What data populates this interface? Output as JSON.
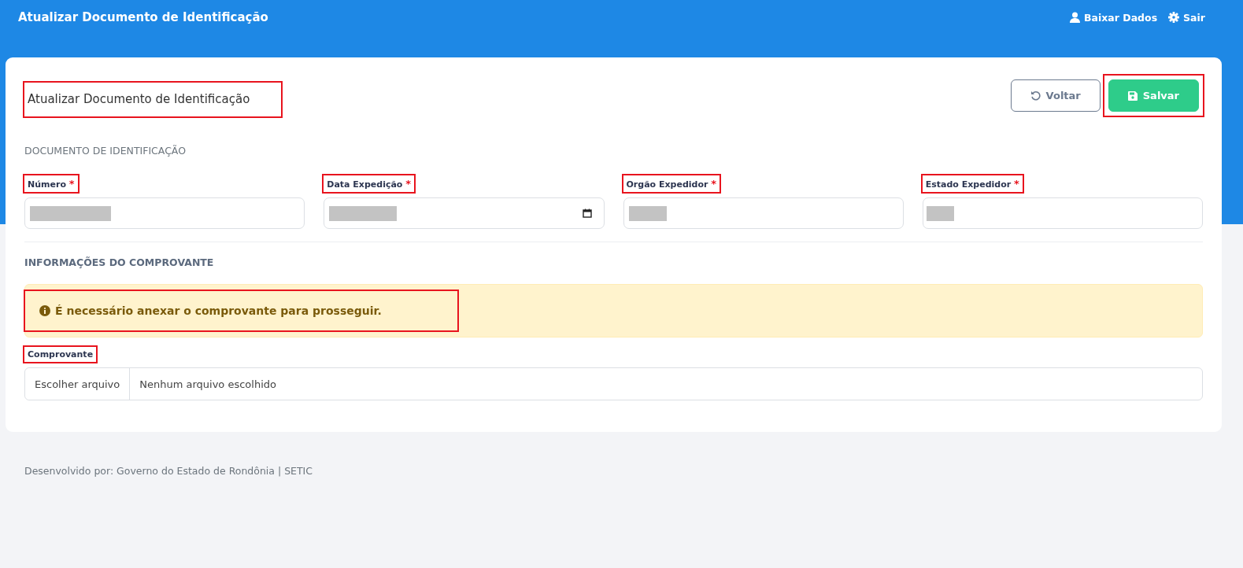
{
  "topbar": {
    "title": "Atualizar Documento de Identificação",
    "actions": [
      {
        "kind": "user",
        "label": "Baixar Dados"
      },
      {
        "kind": "gear",
        "label": "Sair"
      }
    ]
  },
  "page": {
    "title": "Atualizar Documento de Identificação",
    "highlighted": true
  },
  "buttons": [
    {
      "kind": "back",
      "label": "Voltar",
      "highlighted": false
    },
    {
      "kind": "save",
      "label": "Salvar",
      "highlighted": true
    }
  ],
  "section_1": {
    "heading": "DOCUMENTO DE IDENTIFICAÇÃO",
    "fields": [
      {
        "label": "Número",
        "required_mark": "*",
        "kind": "text",
        "redacted": true,
        "highlighted": true
      },
      {
        "label": "Data Expedição",
        "required_mark": "*",
        "kind": "date",
        "redacted": true,
        "highlighted": true
      },
      {
        "label": "Orgão Expedidor",
        "required_mark": "*",
        "kind": "text",
        "redacted": true,
        "highlighted": true
      },
      {
        "label": "Estado Expedidor",
        "required_mark": "*",
        "kind": "text",
        "redacted": true,
        "highlighted": true
      }
    ]
  },
  "section_2": {
    "heading": "INFORMAÇÕES DO COMPROVANTE",
    "alert": {
      "text": "É necessário anexar o comprovante para prosseguir.",
      "highlighted": true
    },
    "file_field": {
      "label": "Comprovante",
      "highlighted": true,
      "button": "Escolher arquivo",
      "value": "Nenhum arquivo escolhido"
    }
  },
  "footer": "Desenvolvido por: Governo do Estado de Rondônia | SETIC"
}
